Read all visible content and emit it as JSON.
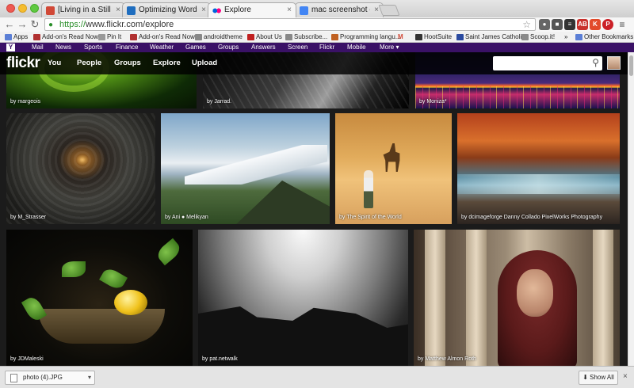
{
  "browser": {
    "tabs": [
      {
        "title": "[Living in a Still Life] Comm",
        "favicon_color": "#d14836"
      },
      {
        "title": "Optimizing WordPress",
        "favicon_color": "#1e6dbf"
      },
      {
        "title": "Explore",
        "favicon_color": "#ff0084"
      },
      {
        "title": "mac screenshot command",
        "favicon_color": "#4285f4"
      }
    ],
    "url_scheme": "https://",
    "url_rest": "www.flickr.com/explore",
    "nav": {
      "back": "←",
      "forward": "→",
      "reload": "↻"
    },
    "bookmarks": [
      {
        "label": "Apps",
        "color": "#5b7fd6"
      },
      {
        "label": "Add-on's Read Now",
        "color": "#b03030"
      },
      {
        "label": "Pin It",
        "color": "#999999"
      },
      {
        "label": "Add-on's Read Now",
        "color": "#b03030"
      },
      {
        "label": "androidtheme",
        "color": "#888888"
      },
      {
        "label": "About Us",
        "color": "#c02020"
      },
      {
        "label": "Subscribe...",
        "color": "#888888"
      },
      {
        "label": "Programming langu...",
        "color": "#c06020"
      },
      {
        "label": "HootSuite",
        "color": "#333333"
      },
      {
        "label": "Saint James Catholi...",
        "color": "#2a4aa0"
      },
      {
        "label": "Scoop.it!",
        "color": "#8a8a8a"
      },
      {
        "label": "»",
        "color": ""
      },
      {
        "label": "Other Bookmarks",
        "color": "#5b7fd6"
      }
    ]
  },
  "yahoo_bar": {
    "logo": "Y",
    "items": [
      "Mail",
      "News",
      "Sports",
      "Finance",
      "Weather",
      "Games",
      "Groups",
      "Answers",
      "Screen",
      "Flickr",
      "Mobile",
      "More ▾"
    ]
  },
  "flickr": {
    "logo": "flickr",
    "nav": [
      "You",
      "People",
      "Groups",
      "Explore",
      "Upload"
    ],
    "search_placeholder": ""
  },
  "photos": [
    {
      "credit": "by margeois"
    },
    {
      "credit": "by Jarrad."
    },
    {
      "credit": "by Moniza*"
    },
    {
      "credit": "by M_Strasser"
    },
    {
      "credit": "by Ani ● Melikyan"
    },
    {
      "credit": "by The Spirit of the World"
    },
    {
      "credit": "by dcimageforge Danny Collado PixelWorks Photography"
    },
    {
      "credit": "by JDMaleski"
    },
    {
      "credit": "by pat.netwalk"
    },
    {
      "credit": "by Matthew Almon Roth"
    }
  ],
  "downloads": {
    "file": "photo (4).JPG",
    "show_all": "Show All",
    "close": "×"
  }
}
